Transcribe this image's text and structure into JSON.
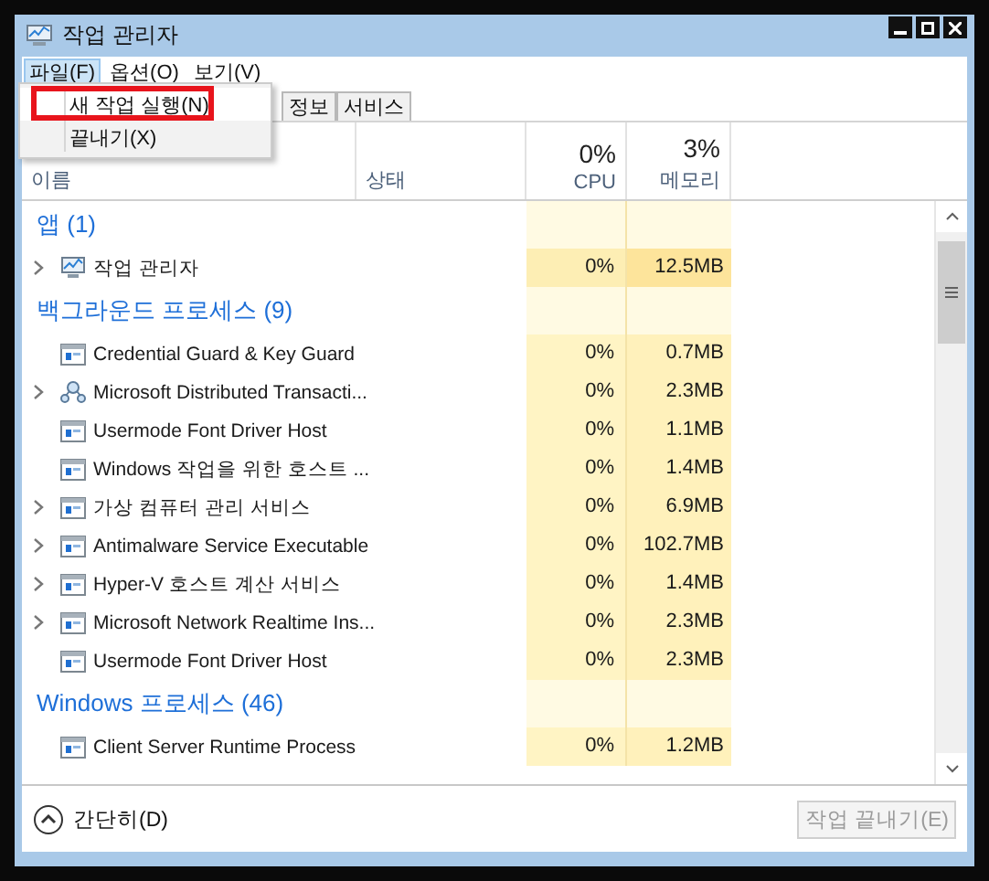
{
  "window": {
    "title": "작업 관리자"
  },
  "menu": [
    {
      "label": "파일(F)",
      "selected": true
    },
    {
      "label": "옵션(O)",
      "selected": false
    },
    {
      "label": "보기(V)",
      "selected": false
    }
  ],
  "file_menu": {
    "items": [
      {
        "label": "새 작업 실행(N)",
        "highlighted": true
      },
      {
        "label": "끝내기(X)",
        "highlighted": false
      }
    ]
  },
  "tabs": [
    {
      "label": "정보",
      "selected": false
    },
    {
      "label": "서비스",
      "selected": false
    }
  ],
  "columns": {
    "name": "이름",
    "status": "상태",
    "cpu_total": "0%",
    "cpu": "CPU",
    "memory_total": "3%",
    "memory": "메모리"
  },
  "groups": [
    {
      "title": "앱 (1)",
      "processes": [
        {
          "kind": "app",
          "name": "작업 관리자",
          "expandable": true,
          "cpu": "0%",
          "memory": "12.5MB"
        }
      ]
    },
    {
      "title": "백그라운드 프로세스 (9)",
      "processes": [
        {
          "kind": "process",
          "name": "Credential Guard & Key Guard",
          "expandable": false,
          "cpu": "0%",
          "memory": "0.7MB"
        },
        {
          "kind": "service",
          "name": "Microsoft Distributed Transacti...",
          "expandable": true,
          "cpu": "0%",
          "memory": "2.3MB"
        },
        {
          "kind": "process",
          "name": "Usermode Font Driver Host",
          "expandable": false,
          "cpu": "0%",
          "memory": "1.1MB"
        },
        {
          "kind": "process",
          "name": "Windows 작업을 위한 호스트 ...",
          "expandable": false,
          "cpu": "0%",
          "memory": "1.4MB"
        },
        {
          "kind": "process",
          "name": "가상 컴퓨터 관리 서비스",
          "expandable": true,
          "cpu": "0%",
          "memory": "6.9MB"
        },
        {
          "kind": "process",
          "name": "Antimalware Service Executable",
          "expandable": true,
          "cpu": "0%",
          "memory": "102.7MB"
        },
        {
          "kind": "process",
          "name": "Hyper-V 호스트 계산 서비스",
          "expandable": true,
          "cpu": "0%",
          "memory": "1.4MB"
        },
        {
          "kind": "process",
          "name": "Microsoft Network Realtime Ins...",
          "expandable": true,
          "cpu": "0%",
          "memory": "2.3MB"
        },
        {
          "kind": "process",
          "name": "Usermode Font Driver Host",
          "expandable": false,
          "cpu": "0%",
          "memory": "2.3MB"
        }
      ]
    },
    {
      "title": "Windows 프로세스 (46)",
      "processes": [
        {
          "kind": "process",
          "name": "Client Server Runtime Process",
          "expandable": false,
          "cpu": "0%",
          "memory": "1.2MB"
        }
      ]
    }
  ],
  "footer": {
    "toggle": "간단히(D)",
    "end_task": {
      "label": "작업 끝내기(E)",
      "disabled": true
    }
  }
}
